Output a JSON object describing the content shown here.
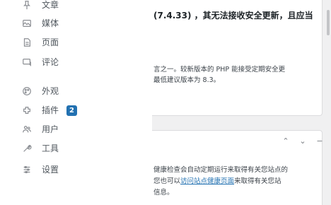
{
  "php_notice": {
    "version_text": "(7.4.33) ，其无法接收安全更新，且应当",
    "body_line1": "言之一。较新版本的 PHP 能接受定期安全更",
    "body_line2": "最低建议版本为 8.3。"
  },
  "site_health": {
    "line1": "健康检查会自动定期运行来取得有关您站点的",
    "line2_prefix": "您也可以",
    "line2_link": "访问站点健康页面",
    "line2_suffix": "来取得有关您站",
    "line3": "信息。",
    "ctrl_up": "⌃",
    "ctrl_down": "⌄",
    "ctrl_close": "−"
  },
  "menu": {
    "items": [
      {
        "label": "文章",
        "icon": "pin-icon"
      },
      {
        "label": "媒体",
        "icon": "media-icon"
      },
      {
        "label": "页面",
        "icon": "page-icon"
      },
      {
        "label": "评论",
        "icon": "comment-icon"
      },
      {
        "label": "外观",
        "icon": "appearance-icon"
      },
      {
        "label": "插件",
        "icon": "plugin-icon",
        "badge": "2"
      },
      {
        "label": "用户",
        "icon": "users-icon"
      },
      {
        "label": "工具",
        "icon": "tools-icon"
      },
      {
        "label": "设置",
        "icon": "settings-icon"
      }
    ]
  },
  "colors": {
    "badge": "#2271b1",
    "link": "#2271b1",
    "menu_bg": "#ffffff",
    "page_bg": "#f0f0f1"
  }
}
